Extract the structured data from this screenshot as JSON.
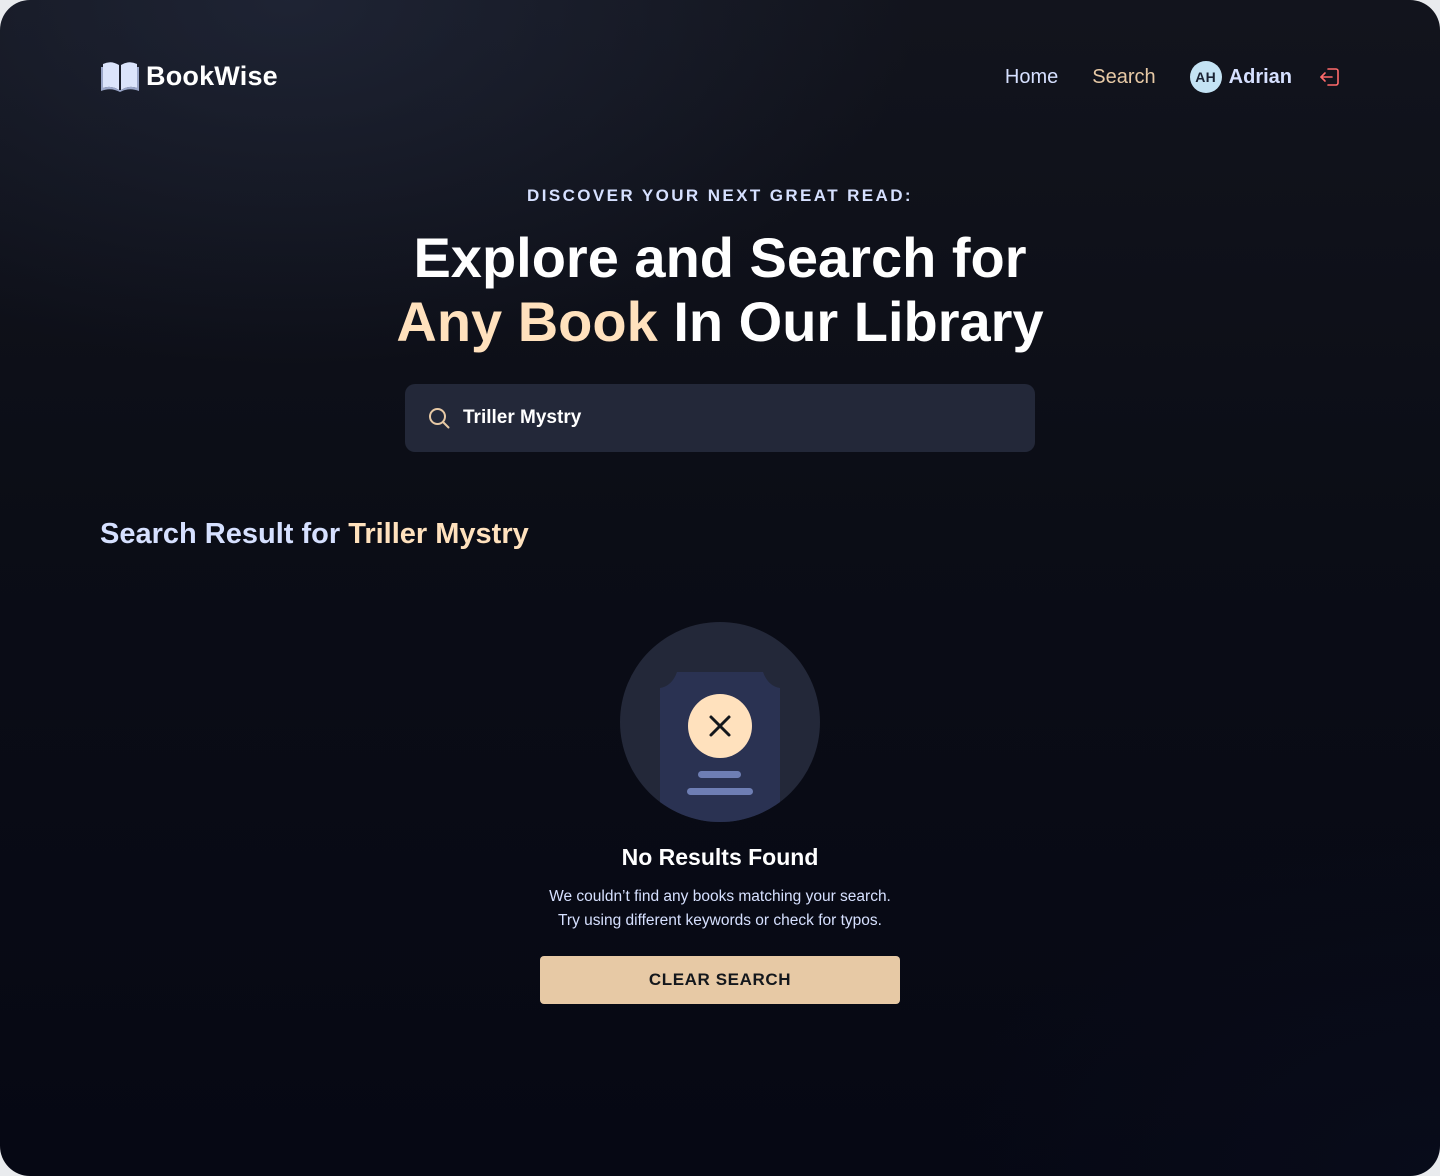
{
  "app": {
    "name": "BookWise"
  },
  "nav": {
    "home_label": "Home",
    "search_label": "Search",
    "user_initials": "AH",
    "user_name": "Adrian"
  },
  "hero": {
    "eyebrow": "DISCOVER YOUR NEXT GREAT READ:",
    "title_line1": "Explore and Search for",
    "title_accent": "Any Book",
    "title_rest": "In Our Library"
  },
  "search": {
    "value": "Triller Mystry"
  },
  "results": {
    "heading_prefix": "Search Result for",
    "query": "Triller Mystry"
  },
  "empty_state": {
    "title": "No Results Found",
    "line1": "We couldn’t find any books matching your search.",
    "line2": "Try using different keywords or check for typos.",
    "button_label": "CLEAR SEARCH"
  },
  "colors": {
    "accent": "#e7c9a5",
    "accent_light": "#ffe1bd",
    "text_muted": "#d6e0ff",
    "search_bg": "#232839",
    "logout": "#ff6b6b"
  },
  "icons": {
    "logo": "open-book-icon",
    "search": "search-icon",
    "logout": "logout-icon",
    "empty": "no-results-book-icon",
    "close": "close-icon"
  }
}
